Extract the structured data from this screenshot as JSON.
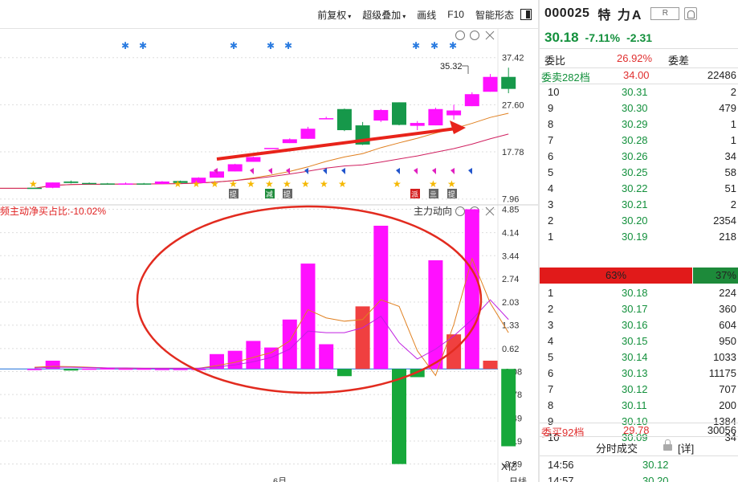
{
  "toolbar": {
    "items": [
      "前复权",
      "超级叠加",
      "画线",
      "F10",
      "智能形态"
    ],
    "caret": "▾"
  },
  "kline": {
    "y_ticks": [
      "37.42",
      "27.60",
      "17.78",
      "7.96"
    ],
    "high_label": "35.32",
    "marker_texts": [
      "提",
      "减",
      "提",
      "派",
      "亖",
      "提"
    ],
    "colors": {
      "up": "#ff10ff",
      "down": "#16984a",
      "ma5": "#e08020",
      "ma10": "#d02060",
      "arrow": "#e8231a",
      "star": "#f5b800",
      "asterisk": "#2a7be0"
    }
  },
  "flow": {
    "label": "频主动净买占比:-10.02%",
    "title": "主力动向",
    "y_ticks": [
      "4.85",
      "4.14",
      "3.44",
      "2.74",
      "2.03",
      "1.33",
      "0.62",
      "-0.08",
      "-0.78",
      "-1.49",
      "-2.19",
      "-2.89"
    ],
    "unit": "X亿",
    "bottom_left": "6月",
    "bottom_right": "日线"
  },
  "chart_data": [
    {
      "type": "candlestick",
      "title": "",
      "ylim": [
        7.96,
        37.42
      ],
      "ohlc": [
        [
          null,
          10.3,
          10.3,
          10.2,
          10.2
        ],
        [
          null,
          10.3,
          11.4,
          10.2,
          11.4
        ],
        [
          null,
          11.6,
          11.8,
          11.2,
          11.3
        ],
        [
          null,
          11.3,
          11.4,
          11.1,
          11.2
        ],
        [
          null,
          11.2,
          11.3,
          11.0,
          11.1
        ],
        [
          null,
          11.1,
          11.4,
          11.0,
          11.2
        ],
        [
          null,
          11.2,
          11.3,
          11.0,
          11.1
        ],
        [
          null,
          11.1,
          11.7,
          11.0,
          11.6
        ],
        [
          null,
          11.7,
          11.8,
          11.2,
          11.3
        ],
        [
          null,
          11.3,
          12.5,
          11.2,
          12.4
        ],
        [
          null,
          12.4,
          14.0,
          12.4,
          13.7
        ],
        [
          null,
          13.7,
          15.3,
          13.7,
          15.2
        ],
        [
          null,
          15.7,
          16.8,
          15.7,
          16.7
        ],
        [
          null,
          18.6,
          18.6,
          18.6,
          18.6
        ],
        [
          null,
          19.6,
          20.6,
          19.6,
          20.4
        ],
        [
          null,
          20.5,
          23.0,
          20.5,
          22.6
        ],
        [
          null,
          24.6,
          25.1,
          24.6,
          24.8
        ],
        [
          null,
          26.7,
          26.8,
          22.1,
          22.3
        ],
        [
          null,
          23.3,
          24.0,
          19.2,
          19.3
        ],
        [
          null,
          24.3,
          26.7,
          24.0,
          26.5
        ],
        [
          null,
          28.1,
          28.1,
          23.3,
          23.4
        ],
        [
          null,
          23.2,
          24.2,
          22.3,
          23.8
        ],
        [
          null,
          23.3,
          27.0,
          23.3,
          26.7
        ],
        [
          null,
          25.4,
          27.6,
          24.5,
          26.4
        ],
        [
          null,
          27.3,
          30.2,
          27.3,
          29.8
        ],
        [
          null,
          30.3,
          34.0,
          30.3,
          33.4
        ],
        [
          null,
          33.4,
          35.32,
          30.0,
          30.9
        ]
      ]
    },
    {
      "type": "bar",
      "title": "主力动向",
      "ylabel": "X亿",
      "ylim": [
        -2.89,
        4.85
      ],
      "values": [
        0.0,
        0.25,
        -0.05,
        0.01,
        0.02,
        0.01,
        0.01,
        0.0,
        0.0,
        0.0,
        0.45,
        0.55,
        0.85,
        0.65,
        1.5,
        3.2,
        0.75,
        -0.22,
        1.9,
        4.35,
        -2.89,
        -0.25,
        3.3,
        1.05,
        4.85,
        0.25,
        -2.35
      ],
      "ma_lines": [
        {
          "values": [
            0.05,
            0.08,
            0.07,
            0.05,
            0.03,
            0.02,
            0.02,
            0.02,
            0.02,
            0.02,
            0.1,
            0.2,
            0.35,
            0.5,
            0.85,
            1.8,
            1.55,
            1.45,
            1.5,
            2.1,
            1.9,
            0.55,
            -0.2,
            1.35,
            3.35,
            2.0,
            1.1
          ]
        },
        {
          "values": [
            0.03,
            0.05,
            0.05,
            0.04,
            0.03,
            0.03,
            0.02,
            0.02,
            0.02,
            0.02,
            0.06,
            0.12,
            0.22,
            0.35,
            0.6,
            1.15,
            1.1,
            1.1,
            1.25,
            1.6,
            0.8,
            0.3,
            0.6,
            1.0,
            1.5,
            2.1,
            1.5
          ]
        }
      ]
    }
  ],
  "stock": {
    "code": "000025",
    "name": "特 力A",
    "badge": "R",
    "price": "30.18",
    "pct": "-7.11%",
    "change": "-2.31",
    "ratio_label": "委比",
    "ratio_value": "26.92%",
    "diff_label": "委差"
  },
  "orderbook": {
    "sell_head": {
      "label": "委卖282档",
      "price": "34.00",
      "vol": "22486"
    },
    "sells": [
      {
        "lvl": "10",
        "price": "30.31",
        "vol": "2"
      },
      {
        "lvl": "9",
        "price": "30.30",
        "vol": "479"
      },
      {
        "lvl": "8",
        "price": "30.29",
        "vol": "1"
      },
      {
        "lvl": "7",
        "price": "30.28",
        "vol": "1"
      },
      {
        "lvl": "6",
        "price": "30.26",
        "vol": "34"
      },
      {
        "lvl": "5",
        "price": "30.25",
        "vol": "58"
      },
      {
        "lvl": "4",
        "price": "30.22",
        "vol": "51"
      },
      {
        "lvl": "3",
        "price": "30.21",
        "vol": "2"
      },
      {
        "lvl": "2",
        "price": "30.20",
        "vol": "2354"
      },
      {
        "lvl": "1",
        "price": "30.19",
        "vol": "218"
      }
    ],
    "bar_left": "63%",
    "bar_right": "37%",
    "buys": [
      {
        "lvl": "1",
        "price": "30.18",
        "vol": "224"
      },
      {
        "lvl": "2",
        "price": "30.17",
        "vol": "360"
      },
      {
        "lvl": "3",
        "price": "30.16",
        "vol": "604"
      },
      {
        "lvl": "4",
        "price": "30.15",
        "vol": "950"
      },
      {
        "lvl": "5",
        "price": "30.14",
        "vol": "1033"
      },
      {
        "lvl": "6",
        "price": "30.13",
        "vol": "11175"
      },
      {
        "lvl": "7",
        "price": "30.12",
        "vol": "707"
      },
      {
        "lvl": "8",
        "price": "30.11",
        "vol": "200"
      },
      {
        "lvl": "9",
        "price": "30.10",
        "vol": "1384"
      },
      {
        "lvl": "10",
        "price": "30.09",
        "vol": "34"
      }
    ],
    "buy_head": {
      "label": "委买92档",
      "price": "29.78",
      "vol": "30056"
    }
  },
  "ticks": {
    "title": "分时成交",
    "detail": "[详]",
    "rows": [
      {
        "time": "14:56",
        "price": "30.12"
      },
      {
        "time": "14:57",
        "price": "30.20"
      }
    ]
  }
}
